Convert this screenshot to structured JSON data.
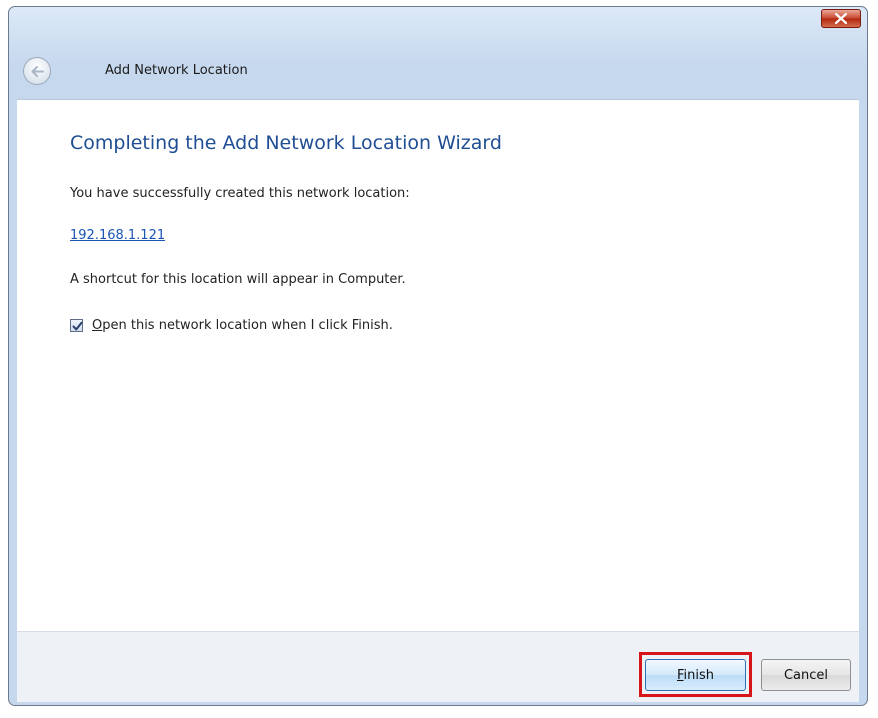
{
  "window": {
    "title": "Add Network Location"
  },
  "wizard": {
    "heading": "Completing the Add Network Location Wizard",
    "success_text": "You have successfully created this network location:",
    "location_link": "192.168.1.121",
    "shortcut_text": "A shortcut for this location will appear in Computer.",
    "open_checkbox": {
      "checked": true,
      "mnemonic": "O",
      "label_rest": "pen this network location when I click Finish."
    }
  },
  "footer": {
    "finish_mnemonic": "F",
    "finish_rest": "inish",
    "cancel_label": "Cancel",
    "highlight_color": "#d7141a"
  },
  "icons": {
    "close": "close-icon",
    "back": "back-arrow-icon",
    "check": "checkmark-icon"
  },
  "colors": {
    "heading": "#1f4e94",
    "link": "#1a55b3"
  }
}
